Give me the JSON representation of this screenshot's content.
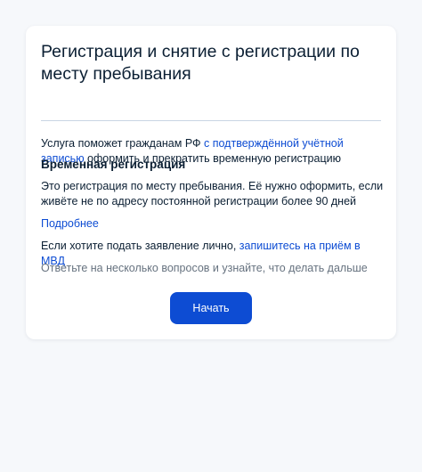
{
  "card": {
    "title": "Регистрация и снятие с регистрации по месту пребывания",
    "intro_prefix": "Услуга поможет гражданам РФ ",
    "intro_link": "с подтверждённой учётной записью",
    "intro_suffix": " оформить и прекратить временную регистрацию",
    "section_heading": "Временная регистрация",
    "section_text": "Это регистрация по месту пребывания. Её нужно оформить, если живёте не по адресу постоянной регистрации более 90 дней",
    "more_link": "Подробнее",
    "inperson_prefix": "Если хотите подать заявление лично, ",
    "inperson_link": "запишитесь на приём в МВД",
    "hint": "Ответьте на несколько вопросов и узнайте, что делать дальше",
    "start_button": "Начать"
  },
  "colors": {
    "accent": "#0d4cd3",
    "text": "#0b1f33",
    "muted": "#66727f",
    "background": "#f6f8fb"
  }
}
